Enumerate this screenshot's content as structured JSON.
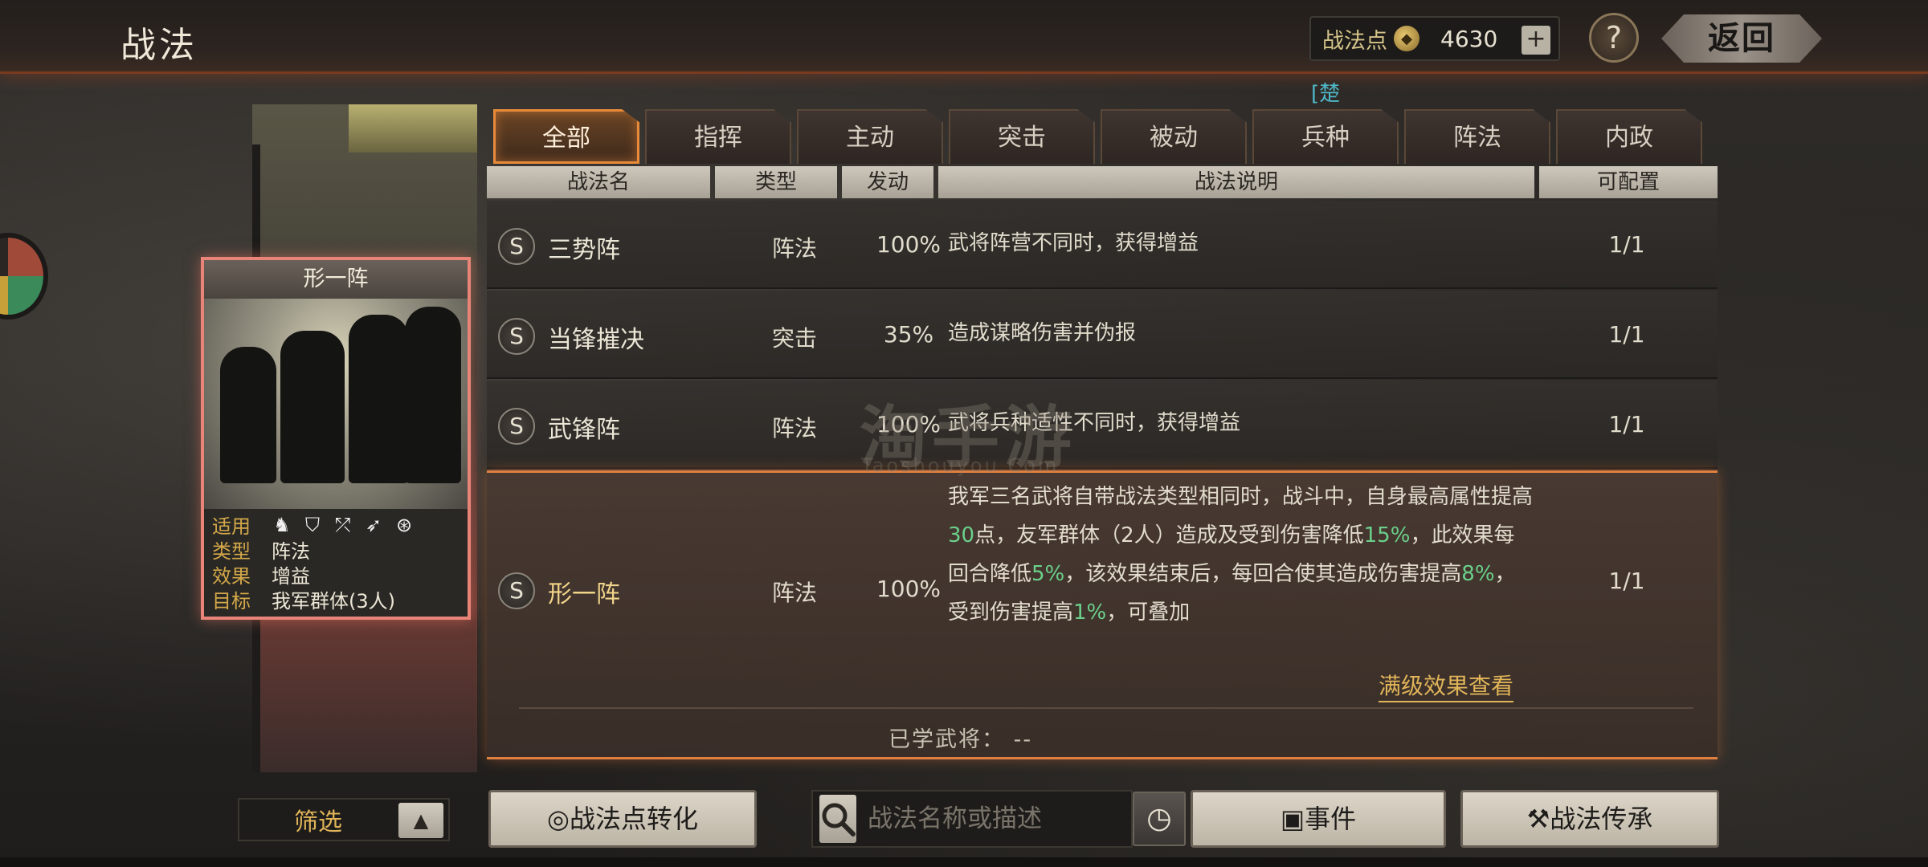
{
  "header": {
    "title": "战法",
    "points_label": "战法点",
    "points_value": "4630",
    "plus": "+",
    "help": "?",
    "back": "返回",
    "faction_tag": "[楚"
  },
  "selected_card": {
    "title": "形一阵",
    "rows": [
      {
        "key": "适用",
        "value": ""
      },
      {
        "key": "类型",
        "value": "阵法"
      },
      {
        "key": "效果",
        "value": "增益"
      },
      {
        "key": "目标",
        "value": "我军群体(3人)"
      }
    ],
    "unit_icons": [
      "cavalry-icon",
      "shield-icon",
      "bow-icon",
      "spear-icon",
      "wheel-icon"
    ]
  },
  "tabs": [
    "全部",
    "指挥",
    "主动",
    "突击",
    "被动",
    "兵种",
    "阵法",
    "内政"
  ],
  "active_tab": 0,
  "columns": [
    "战法名",
    "类型",
    "发动",
    "战法说明",
    "可配置"
  ],
  "rows": [
    {
      "grade": "S",
      "name": "三势阵",
      "type": "阵法",
      "rate": "100%",
      "desc": "武将阵营不同时，获得增益",
      "conf": "1/1"
    },
    {
      "grade": "S",
      "name": "当锋摧决",
      "type": "突击",
      "rate": "35%",
      "desc": "造成谋略伤害并伪报",
      "conf": "1/1"
    },
    {
      "grade": "S",
      "name": "武锋阵",
      "type": "阵法",
      "rate": "100%",
      "desc": "武将兵种适性不同时，获得增益",
      "conf": "1/1"
    }
  ],
  "selected_row": {
    "grade": "S",
    "name": "形一阵",
    "type": "阵法",
    "rate": "100%",
    "desc_parts": {
      "p1": "我军三名武将自带战法类型相同时，战斗中，自身最高属性提高",
      "v1": "30",
      "p2": "点，友军群体（2人）造成及受到伤害降低",
      "v2": "15%",
      "p3": "，此效果每回合降低",
      "v3": "5%",
      "p4": "，该效果结束后，每回合使其造成伤害提高",
      "v4": "8%",
      "p5": "，受到伤害提高",
      "v5": "1%",
      "p6": "，可叠加"
    },
    "conf": "1/1",
    "full_effect_link": "满级效果查看",
    "learned_label": "已学武将：",
    "learned_value": "--"
  },
  "watermark": {
    "main": "淘手游",
    "sub": "Taoshouyou.Com"
  },
  "bottom": {
    "filter_label": "筛选",
    "convert_button": "战法点转化",
    "search_placeholder": "战法名称或描述",
    "event_button": "事件",
    "inherit_button": "战法传承"
  },
  "colors": {
    "accent": "#e88a3a",
    "highlight": "#6ad08a",
    "gold": "#e0b458"
  }
}
